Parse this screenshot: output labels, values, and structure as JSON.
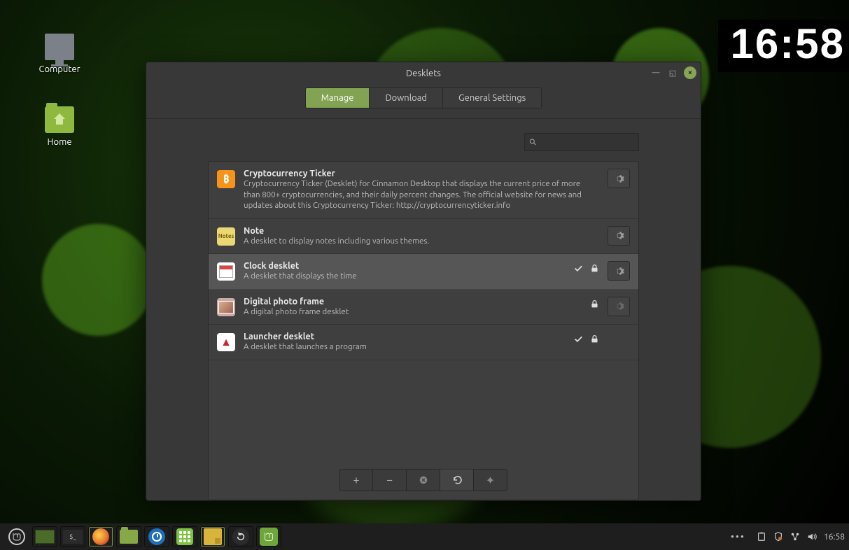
{
  "desktop": {
    "icons": [
      {
        "name": "computer",
        "label": "Computer"
      },
      {
        "name": "home",
        "label": "Home"
      }
    ]
  },
  "clock_desklet": {
    "time": "16:58"
  },
  "window": {
    "title": "Desklets",
    "tabs": {
      "manage": "Manage",
      "download": "Download",
      "general": "General Settings",
      "active": "manage"
    },
    "search": {
      "placeholder": ""
    },
    "items": [
      {
        "icon": "bitcoin",
        "title": "Cryptocurrency Ticker",
        "desc": "Cryptocurrency Ticker (Desklet) for Cinnamon Desktop that displays the current price of more than 800+ cryptocurrencies, and their daily percent changes. The official website for news and updates about this Cryptocurrency Ticker: http://cryptocurrencyticker.info",
        "checked": false,
        "locked": false,
        "has_settings": true,
        "selected": false
      },
      {
        "icon": "note",
        "title": "Note",
        "desc": "A desklet to display notes including various themes.",
        "checked": false,
        "locked": false,
        "has_settings": true,
        "selected": false
      },
      {
        "icon": "calendar",
        "title": "Clock desklet",
        "desc": "A desklet that displays the time",
        "checked": true,
        "locked": true,
        "has_settings": true,
        "selected": true
      },
      {
        "icon": "photo",
        "title": "Digital photo frame",
        "desc": "A digital photo frame desklet",
        "checked": false,
        "locked": true,
        "has_settings": true,
        "settings_disabled": true,
        "selected": false
      },
      {
        "icon": "launcher",
        "title": "Launcher desklet",
        "desc": "A desklet that launches a program",
        "checked": true,
        "locked": true,
        "has_settings": false,
        "selected": false
      }
    ],
    "toolbar": {
      "add": "+",
      "remove": "−",
      "delete": "✕",
      "undo": "↶",
      "star": "✦"
    }
  },
  "panel": {
    "apps": [
      {
        "name": "menu",
        "color": "#1e1e1e"
      },
      {
        "name": "show-desktop",
        "color": "#4a6b2a"
      },
      {
        "name": "terminal",
        "color": "#2a2a2a"
      },
      {
        "name": "firefox",
        "color": "#e67a2e"
      },
      {
        "name": "files",
        "color": "#86a847"
      },
      {
        "name": "clock-app",
        "color": "#1d6fb8"
      },
      {
        "name": "apps-grid",
        "color": "#7fc241"
      },
      {
        "name": "notes",
        "color": "#d9b43a"
      },
      {
        "name": "restart",
        "color": "#2b2b2b"
      },
      {
        "name": "mint",
        "color": "#6fa63c"
      }
    ],
    "tray": {
      "time": "16:58"
    }
  }
}
